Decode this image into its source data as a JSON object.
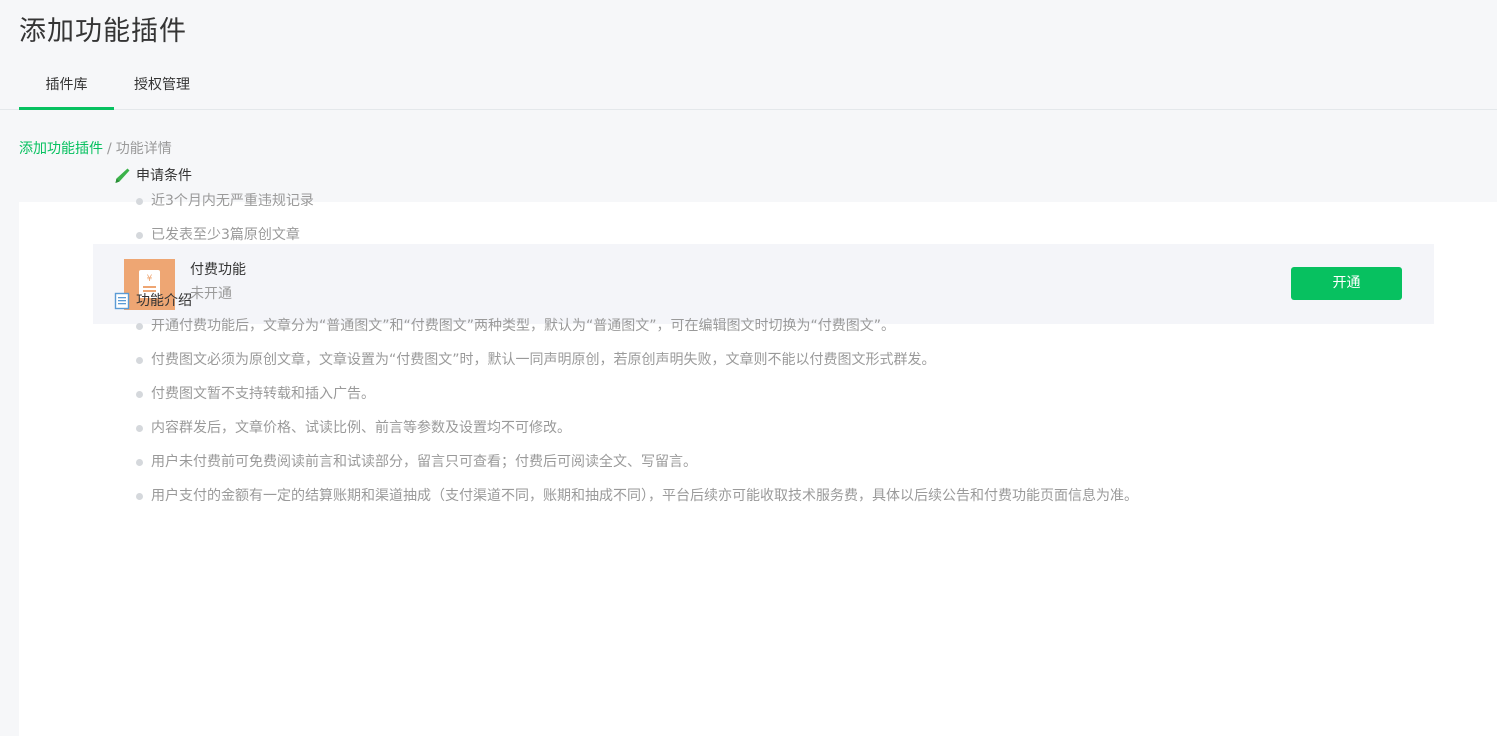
{
  "header": {
    "title": "添加功能插件"
  },
  "tabs": [
    {
      "label": "插件库",
      "active": true
    },
    {
      "label": "授权管理",
      "active": false
    }
  ],
  "breadcrumb": {
    "parent": "添加功能插件",
    "separator": "/",
    "current": "功能详情"
  },
  "plugin": {
    "icon": "yuan-receipt-icon",
    "name": "付费功能",
    "status": "未开通",
    "action_label": "开通"
  },
  "sections": {
    "requirements": {
      "icon": "pen-icon",
      "title": "申请条件",
      "items": [
        "近3个月内无严重违规记录",
        "已发表至少3篇原创文章"
      ]
    },
    "intro": {
      "icon": "document-icon",
      "title": "功能介绍",
      "items": [
        "开通付费功能后，文章分为“普通图文”和“付费图文”两种类型，默认为“普通图文”，可在编辑图文时切换为“付费图文”。",
        "付费图文必须为原创文章，文章设置为“付费图文”时，默认一同声明原创，若原创声明失败，文章则不能以付费图文形式群发。",
        "付费图文暂不支持转载和插入广告。",
        "内容群发后，文章价格、试读比例、前言等参数及设置均不可修改。",
        "用户未付费前可免费阅读前言和试读部分，留言只可查看；付费后可阅读全文、写留言。",
        "用户支付的金额有一定的结算账期和渠道抽成（支付渠道不同，账期和抽成不同），平台后续亦可能收取技术服务费，具体以后续公告和付费功能页面信息为准。"
      ]
    }
  },
  "colors": {
    "accent": "#07c160",
    "icon_bg": "#eea673",
    "muted_text": "#9a9a9a"
  }
}
